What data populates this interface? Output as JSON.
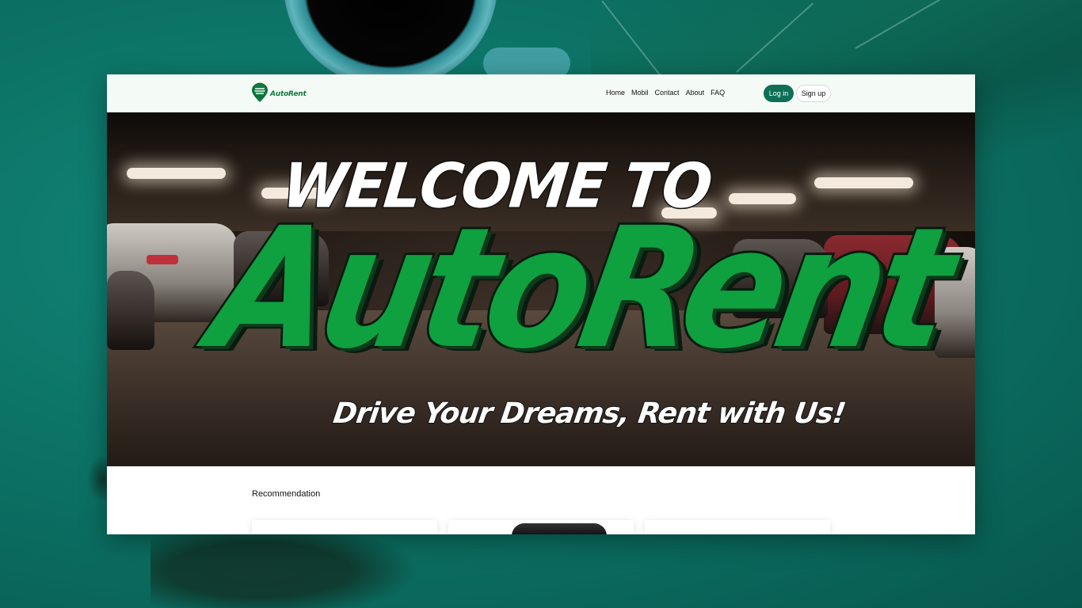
{
  "brand": {
    "name": "AutoRent",
    "accent": "#0e6e56",
    "green": "#0fa040"
  },
  "nav": {
    "links": [
      "Home",
      "Mobil",
      "Contact",
      "About",
      "FAQ"
    ],
    "login_label": "Log in",
    "signup_label": "Sign up"
  },
  "hero": {
    "welcome": "WELCOME TO",
    "title": "AutoRent",
    "tagline": "Drive Your Dreams, Rent with Us!"
  },
  "recommendation": {
    "title": "Recommendation",
    "cards_count": 3
  }
}
